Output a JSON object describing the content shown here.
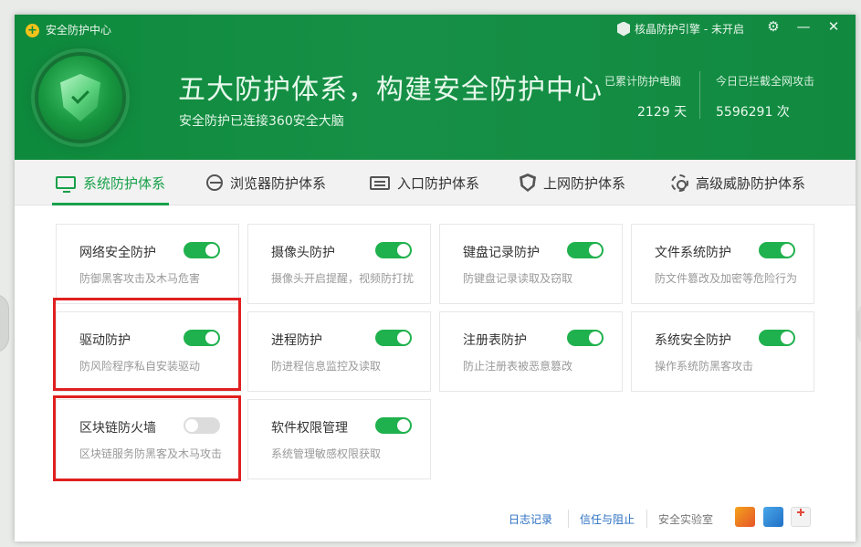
{
  "app": {
    "title": "安全防护中心",
    "engine_label": "核晶防护引擎 - 未开启"
  },
  "hero": {
    "headline": "五大防护体系，构建安全防护中心",
    "subline": "安全防护已连接360安全大脑",
    "stats": [
      {
        "label": "已累计防护电脑",
        "value": "2129 天"
      },
      {
        "label": "今日已拦截全网攻击",
        "value": "5596291 次"
      }
    ]
  },
  "tabs": [
    {
      "label": "系统防护体系",
      "icon": "monitor-icon",
      "active": true
    },
    {
      "label": "浏览器防护体系",
      "icon": "browser-icon",
      "active": false
    },
    {
      "label": "入口防护体系",
      "icon": "entry-icon",
      "active": false
    },
    {
      "label": "上网防护体系",
      "icon": "shield-pulse-icon",
      "active": false
    },
    {
      "label": "高级威胁防护体系",
      "icon": "gear-icon",
      "active": false
    }
  ],
  "cards": [
    {
      "title": "网络安全防护",
      "desc": "防御黑客攻击及木马危害",
      "enabled": true
    },
    {
      "title": "摄像头防护",
      "desc": "摄像头开启提醒，视频防打扰",
      "enabled": true
    },
    {
      "title": "键盘记录防护",
      "desc": "防键盘记录读取及窃取",
      "enabled": true
    },
    {
      "title": "文件系统防护",
      "desc": "防文件篡改及加密等危险行为",
      "enabled": true
    },
    {
      "title": "驱动防护",
      "desc": "防风险程序私自安装驱动",
      "enabled": true
    },
    {
      "title": "进程防护",
      "desc": "防进程信息监控及读取",
      "enabled": true
    },
    {
      "title": "注册表防护",
      "desc": "防止注册表被恶意篡改",
      "enabled": true
    },
    {
      "title": "系统安全防护",
      "desc": "操作系统防黑客攻击",
      "enabled": true
    },
    {
      "title": "区块链防火墙",
      "desc": "区块链服务防黑客及木马攻击",
      "enabled": false
    },
    {
      "title": "软件权限管理",
      "desc": "系统管理敏感权限获取",
      "enabled": true
    }
  ],
  "footer": {
    "log": "日志记录",
    "trust": "信任与阻止",
    "lab": "安全实验室"
  },
  "colors": {
    "header_green": "#118a40",
    "accent_green": "#1fb14d",
    "link_blue": "#2b6fc2",
    "highlight_red": "#e02020"
  }
}
